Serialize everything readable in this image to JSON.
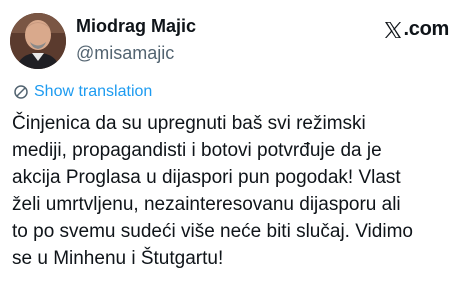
{
  "author": {
    "display_name": "Miodrag Majic",
    "handle": "@misamajic",
    "avatar_icon": "user-photo"
  },
  "brand": {
    "label": ".com",
    "icon": "x-logo-icon"
  },
  "translation": {
    "label": "Show translation",
    "icon": "translate-icon",
    "color": "#1d9bf0"
  },
  "post": {
    "lines": [
      "Činjenica da su upregnuti baš svi režimski",
      "mediji, propagandisti i botovi potvrđuje da je",
      "akcija Proglasa u dijaspori pun pogodak! Vlast",
      "želi umrtvljenu, nezainteresovanu dijasporu ali",
      "to po svemu sudeći više neće biti slučaj. Vidimo",
      "se u Minhenu i Štutgartu!"
    ]
  }
}
